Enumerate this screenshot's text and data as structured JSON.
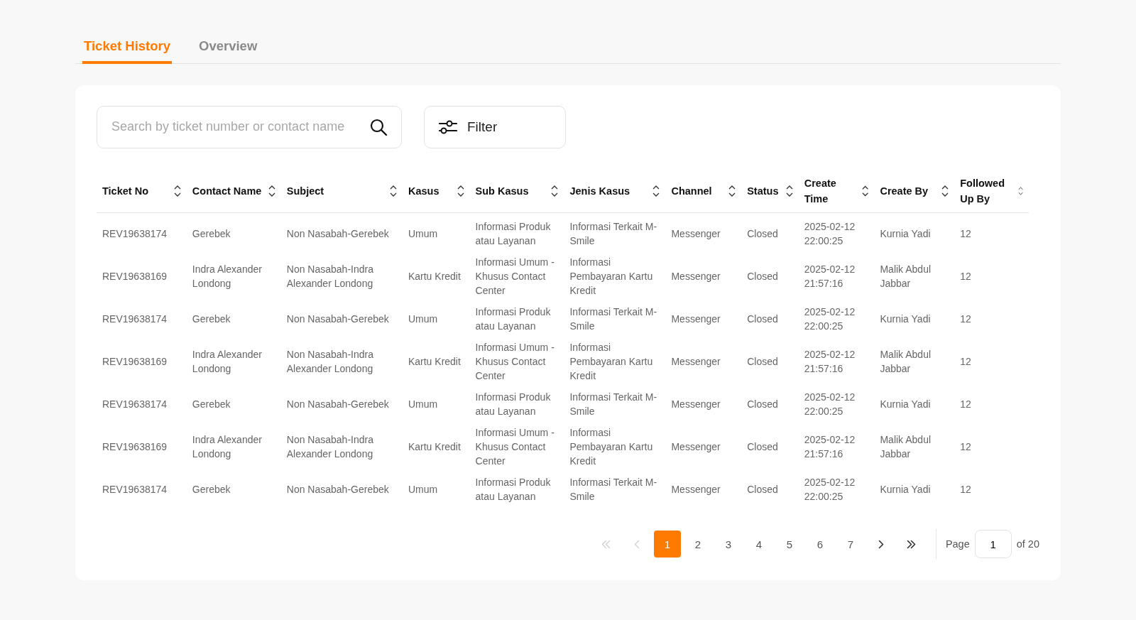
{
  "tabs": [
    {
      "label": "Ticket History",
      "selected": true
    },
    {
      "label": "Overview",
      "selected": false
    }
  ],
  "search": {
    "placeholder": "Search by ticket number or contact name"
  },
  "filter_button": {
    "label": "Filter"
  },
  "table": {
    "columns": [
      "Ticket No",
      "Contact Name",
      "Subject",
      "Kasus",
      "Sub Kasus",
      "Jenis Kasus",
      "Channel",
      "Status",
      "Create Time",
      "Create By",
      "Followed Up By"
    ],
    "rows": [
      [
        "REV19638174",
        "Gerebek",
        "Non Nasabah-Gerebek",
        "Umum",
        "Informasi Produk atau Layanan",
        "Informasi Terkait M-Smile",
        "Messenger",
        "Closed",
        "2025-02-12 22:00:25",
        "Kurnia Yadi",
        "12"
      ],
      [
        "REV19638169",
        "Indra Alexander Londong",
        "Non Nasabah-Indra Alexander Londong",
        "Kartu Kredit",
        "Informasi Umum - Khusus Contact Center",
        "Informasi Pembayaran Kartu Kredit",
        "Messenger",
        "Closed",
        "2025-02-12 21:57:16",
        "Malik Abdul Jabbar",
        "12"
      ],
      [
        "REV19638174",
        "Gerebek",
        "Non Nasabah-Gerebek",
        "Umum",
        "Informasi Produk atau Layanan",
        "Informasi Terkait M-Smile",
        "Messenger",
        "Closed",
        "2025-02-12 22:00:25",
        "Kurnia Yadi",
        "12"
      ],
      [
        "REV19638169",
        "Indra Alexander Londong",
        "Non Nasabah-Indra Alexander Londong",
        "Kartu Kredit",
        "Informasi Umum - Khusus Contact Center",
        "Informasi Pembayaran Kartu Kredit",
        "Messenger",
        "Closed",
        "2025-02-12 21:57:16",
        "Malik Abdul Jabbar",
        "12"
      ],
      [
        "REV19638174",
        "Gerebek",
        "Non Nasabah-Gerebek",
        "Umum",
        "Informasi Produk atau Layanan",
        "Informasi Terkait M-Smile",
        "Messenger",
        "Closed",
        "2025-02-12 22:00:25",
        "Kurnia Yadi",
        "12"
      ],
      [
        "REV19638169",
        "Indra Alexander Londong",
        "Non Nasabah-Indra Alexander Londong",
        "Kartu Kredit",
        "Informasi Umum - Khusus Contact Center",
        "Informasi Pembayaran Kartu Kredit",
        "Messenger",
        "Closed",
        "2025-02-12 21:57:16",
        "Malik Abdul Jabbar",
        "12"
      ],
      [
        "REV19638174",
        "Gerebek",
        "Non Nasabah-Gerebek",
        "Umum",
        "Informasi Produk atau Layanan",
        "Informasi Terkait M-Smile",
        "Messenger",
        "Closed",
        "2025-02-12 22:00:25",
        "Kurnia Yadi",
        "12"
      ]
    ]
  },
  "pagination": {
    "items": [
      {
        "kind": "first",
        "disabled": true
      },
      {
        "kind": "prev",
        "disabled": true
      },
      {
        "kind": "page",
        "label": "1",
        "selected": true
      },
      {
        "kind": "page",
        "label": "2",
        "selected": false
      },
      {
        "kind": "page",
        "label": "3",
        "selected": false
      },
      {
        "kind": "page",
        "label": "4",
        "selected": false
      },
      {
        "kind": "page",
        "label": "5",
        "selected": false
      },
      {
        "kind": "page",
        "label": "6",
        "selected": false
      },
      {
        "kind": "page",
        "label": "7",
        "selected": false
      },
      {
        "kind": "next",
        "disabled": false
      },
      {
        "kind": "last",
        "disabled": false
      }
    ],
    "page_label": "Page",
    "page_value": "1",
    "total_label": "of 20"
  }
}
